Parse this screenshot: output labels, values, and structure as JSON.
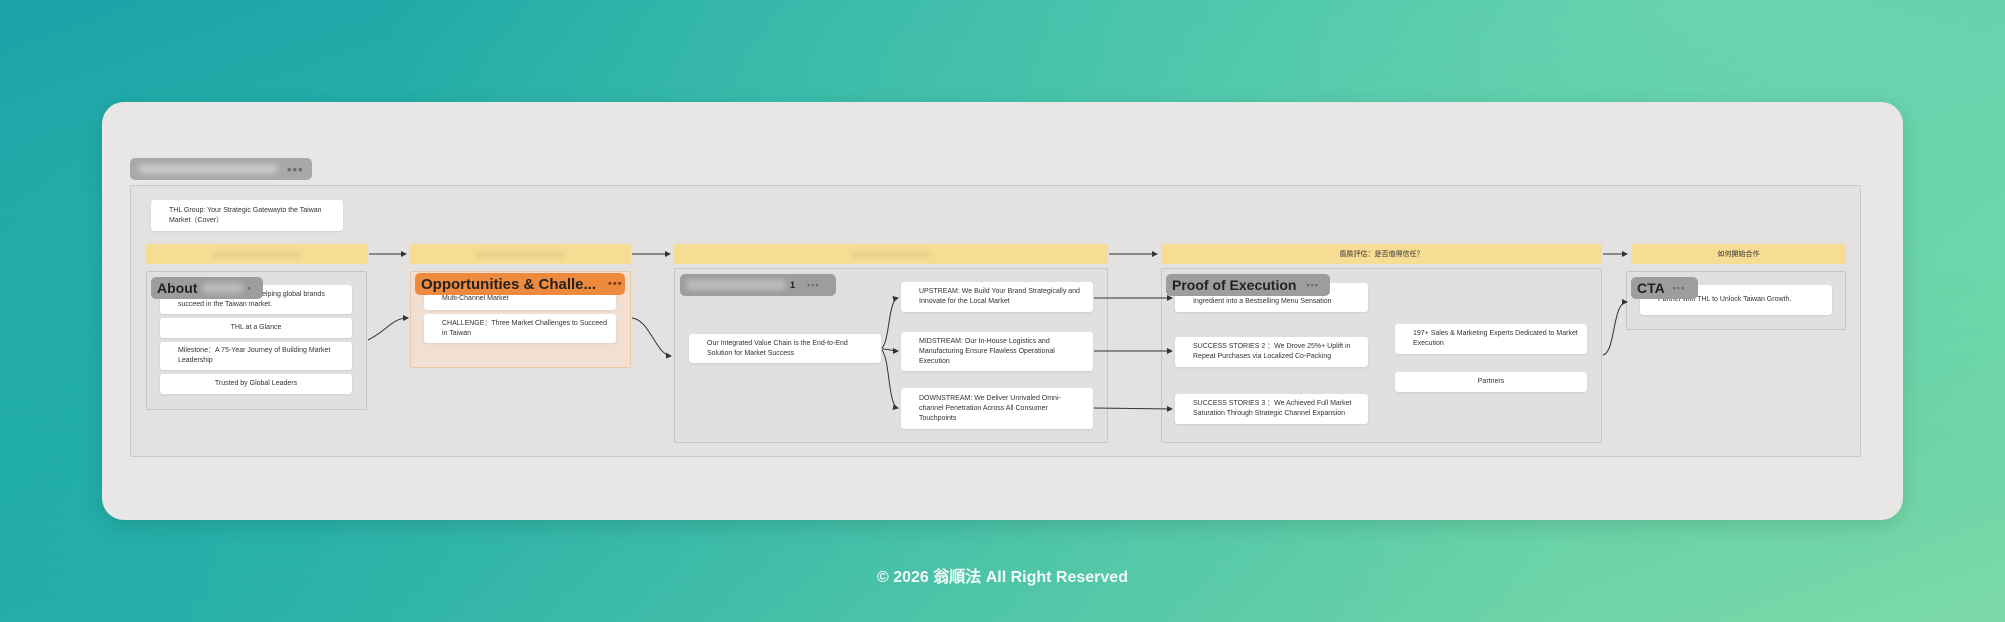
{
  "board": {
    "cover_note": "THL Group: Your Strategic Gatewayto the Taiwan Market（Cover）",
    "band_risk": "風險評估：是否值得信任？",
    "band_cooperate": "如何開始合作"
  },
  "about": {
    "tag_label": "About",
    "notes": [
      "THL is a strategic partner helping global brands succeed in the Taiwan market.",
      "THL at a Glance",
      "Milestone：A 75-Year Journey of Building Market Leadership",
      "Trusted by Global Leaders"
    ]
  },
  "opportunities": {
    "tag_label": "Opportunities & Challe...",
    "notes": [
      "Multi-Channel Market",
      "CHALLENGE：Three Market Challenges to Succeed in Taiwan"
    ]
  },
  "value_chain": {
    "center_note": "Our Integrated Value Chain is the End-to-End Solution for Market Success",
    "upstream": "UPSTREAM: We Build Your Brand Strategically and Innovate for the Local Market",
    "midstream": "MIDSTREAM: Our In-House Logistics and Manufacturing Ensure Flawless Operational Execution",
    "downstream": "DOWNSTREAM: We Deliver Unrivaled Omni-channel Penetration Across All Consumer Touchpoints"
  },
  "proof": {
    "tag_label": "Proof of Execution",
    "notes": [
      "Ingredient into a Bestselling Menu Sensation",
      "SUCCESS STORIES 2 ：We Drove 25%+ Uplift in Repeat Purchases via Localized Co-Packing",
      "SUCCESS STORIES 3 ：We Achieved Full Market Saturation Through Strategic Channel Expansion",
      "197+ Sales & Marketing Experts Dedicated to Market Execution",
      "Partners"
    ]
  },
  "cta": {
    "tag_label": "CTA",
    "note": "Partner with THL to Unlock Taiwan Growth."
  },
  "footer": {
    "text": "© 2026 翁順法 All Right Reserved"
  }
}
